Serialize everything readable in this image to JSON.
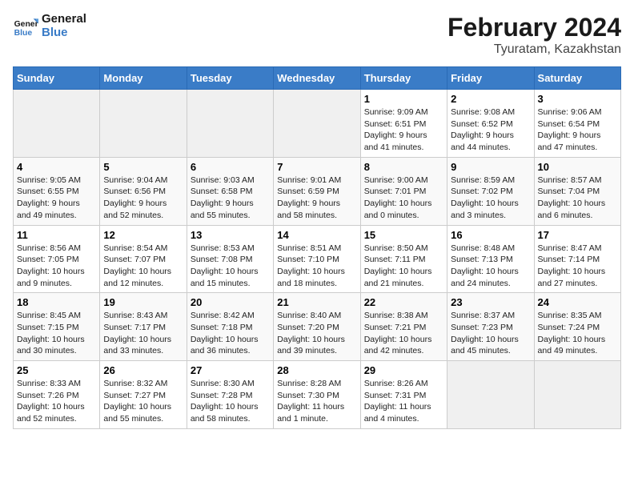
{
  "header": {
    "logo_general": "General",
    "logo_blue": "Blue",
    "title": "February 2024",
    "subtitle": "Tyuratam, Kazakhstan"
  },
  "calendar": {
    "days_of_week": [
      "Sunday",
      "Monday",
      "Tuesday",
      "Wednesday",
      "Thursday",
      "Friday",
      "Saturday"
    ],
    "weeks": [
      [
        {
          "day": "",
          "info": ""
        },
        {
          "day": "",
          "info": ""
        },
        {
          "day": "",
          "info": ""
        },
        {
          "day": "",
          "info": ""
        },
        {
          "day": "1",
          "info": "Sunrise: 9:09 AM\nSunset: 6:51 PM\nDaylight: 9 hours\nand 41 minutes."
        },
        {
          "day": "2",
          "info": "Sunrise: 9:08 AM\nSunset: 6:52 PM\nDaylight: 9 hours\nand 44 minutes."
        },
        {
          "day": "3",
          "info": "Sunrise: 9:06 AM\nSunset: 6:54 PM\nDaylight: 9 hours\nand 47 minutes."
        }
      ],
      [
        {
          "day": "4",
          "info": "Sunrise: 9:05 AM\nSunset: 6:55 PM\nDaylight: 9 hours\nand 49 minutes."
        },
        {
          "day": "5",
          "info": "Sunrise: 9:04 AM\nSunset: 6:56 PM\nDaylight: 9 hours\nand 52 minutes."
        },
        {
          "day": "6",
          "info": "Sunrise: 9:03 AM\nSunset: 6:58 PM\nDaylight: 9 hours\nand 55 minutes."
        },
        {
          "day": "7",
          "info": "Sunrise: 9:01 AM\nSunset: 6:59 PM\nDaylight: 9 hours\nand 58 minutes."
        },
        {
          "day": "8",
          "info": "Sunrise: 9:00 AM\nSunset: 7:01 PM\nDaylight: 10 hours\nand 0 minutes."
        },
        {
          "day": "9",
          "info": "Sunrise: 8:59 AM\nSunset: 7:02 PM\nDaylight: 10 hours\nand 3 minutes."
        },
        {
          "day": "10",
          "info": "Sunrise: 8:57 AM\nSunset: 7:04 PM\nDaylight: 10 hours\nand 6 minutes."
        }
      ],
      [
        {
          "day": "11",
          "info": "Sunrise: 8:56 AM\nSunset: 7:05 PM\nDaylight: 10 hours\nand 9 minutes."
        },
        {
          "day": "12",
          "info": "Sunrise: 8:54 AM\nSunset: 7:07 PM\nDaylight: 10 hours\nand 12 minutes."
        },
        {
          "day": "13",
          "info": "Sunrise: 8:53 AM\nSunset: 7:08 PM\nDaylight: 10 hours\nand 15 minutes."
        },
        {
          "day": "14",
          "info": "Sunrise: 8:51 AM\nSunset: 7:10 PM\nDaylight: 10 hours\nand 18 minutes."
        },
        {
          "day": "15",
          "info": "Sunrise: 8:50 AM\nSunset: 7:11 PM\nDaylight: 10 hours\nand 21 minutes."
        },
        {
          "day": "16",
          "info": "Sunrise: 8:48 AM\nSunset: 7:13 PM\nDaylight: 10 hours\nand 24 minutes."
        },
        {
          "day": "17",
          "info": "Sunrise: 8:47 AM\nSunset: 7:14 PM\nDaylight: 10 hours\nand 27 minutes."
        }
      ],
      [
        {
          "day": "18",
          "info": "Sunrise: 8:45 AM\nSunset: 7:15 PM\nDaylight: 10 hours\nand 30 minutes."
        },
        {
          "day": "19",
          "info": "Sunrise: 8:43 AM\nSunset: 7:17 PM\nDaylight: 10 hours\nand 33 minutes."
        },
        {
          "day": "20",
          "info": "Sunrise: 8:42 AM\nSunset: 7:18 PM\nDaylight: 10 hours\nand 36 minutes."
        },
        {
          "day": "21",
          "info": "Sunrise: 8:40 AM\nSunset: 7:20 PM\nDaylight: 10 hours\nand 39 minutes."
        },
        {
          "day": "22",
          "info": "Sunrise: 8:38 AM\nSunset: 7:21 PM\nDaylight: 10 hours\nand 42 minutes."
        },
        {
          "day": "23",
          "info": "Sunrise: 8:37 AM\nSunset: 7:23 PM\nDaylight: 10 hours\nand 45 minutes."
        },
        {
          "day": "24",
          "info": "Sunrise: 8:35 AM\nSunset: 7:24 PM\nDaylight: 10 hours\nand 49 minutes."
        }
      ],
      [
        {
          "day": "25",
          "info": "Sunrise: 8:33 AM\nSunset: 7:26 PM\nDaylight: 10 hours\nand 52 minutes."
        },
        {
          "day": "26",
          "info": "Sunrise: 8:32 AM\nSunset: 7:27 PM\nDaylight: 10 hours\nand 55 minutes."
        },
        {
          "day": "27",
          "info": "Sunrise: 8:30 AM\nSunset: 7:28 PM\nDaylight: 10 hours\nand 58 minutes."
        },
        {
          "day": "28",
          "info": "Sunrise: 8:28 AM\nSunset: 7:30 PM\nDaylight: 11 hours\nand 1 minute."
        },
        {
          "day": "29",
          "info": "Sunrise: 8:26 AM\nSunset: 7:31 PM\nDaylight: 11 hours\nand 4 minutes."
        },
        {
          "day": "",
          "info": ""
        },
        {
          "day": "",
          "info": ""
        }
      ]
    ]
  }
}
